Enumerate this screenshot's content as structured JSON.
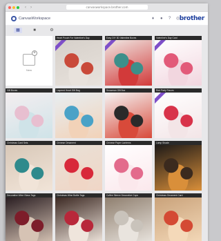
{
  "browser": {
    "url": "canvasworkspace.brother.com"
  },
  "header": {
    "app_title": "CanvasWorkspace",
    "brand": "brother",
    "icons": [
      "lightbulb-icon",
      "user-icon",
      "help-icon",
      "globe-icon"
    ]
  },
  "toolbar": {
    "icons": [
      "grid-view-icon",
      "category-icon",
      "settings-icon"
    ]
  },
  "upload": {
    "label": "New"
  },
  "projects": [
    {
      "caption": "Heart Pouch For Valentine's Day",
      "ribbon": true,
      "palette": [
        "#c94a3a",
        "#e8e2dc",
        "#d6d0ca"
      ]
    },
    {
      "caption": "Easy DIY 3D Valentine Boxes",
      "ribbon": true,
      "palette": [
        "#3d8f8a",
        "#d23a3a",
        "#efe7e3"
      ]
    },
    {
      "caption": "Valentine's Day Card",
      "ribbon": true,
      "palette": [
        "#e25a79",
        "#f2d6df",
        "#ffffff"
      ]
    },
    {
      "caption": "Gift Boxes",
      "ribbon": false,
      "palette": [
        "#e8bfd0",
        "#cfe3e8",
        "#f4eef0"
      ]
    },
    {
      "caption": "Layered Heart Gift Bag",
      "ribbon": false,
      "palette": [
        "#4aa2c7",
        "#f2d2b8",
        "#e7eef2"
      ]
    },
    {
      "caption": "Snowman Gift Box",
      "ribbon": false,
      "palette": [
        "#2a2a2a",
        "#d84a3a",
        "#f5f5f5"
      ]
    },
    {
      "caption": "Red Party Favors",
      "ribbon": true,
      "palette": [
        "#d8334a",
        "#f3e5e7",
        "#ffffff"
      ]
    },
    {
      "caption": "Christmas Card Sets",
      "ribbon": false,
      "palette": [
        "#2f8a8c",
        "#f1e4d8",
        "#d8c8b8"
      ]
    },
    {
      "caption": "Chinese Ornament",
      "ribbon": false,
      "palette": [
        "#d8293a",
        "#f0d6c6",
        "#e9e0d6"
      ]
    },
    {
      "caption": "Chinese Paper Lanterns",
      "ribbon": false,
      "palette": [
        "#e36b8c",
        "#fbe8ec",
        "#ffffff"
      ]
    },
    {
      "caption": "Lamp Shade",
      "ribbon": false,
      "palette": [
        "#3b2a1e",
        "#d98f3a",
        "#1e1a18"
      ]
    },
    {
      "caption": "Decorative Wine Glass Tags",
      "ribbon": false,
      "palette": [
        "#7d1d2a",
        "#d6c3b4",
        "#2a1e22"
      ]
    },
    {
      "caption": "Christmas Wine Bottle Tags",
      "ribbon": false,
      "palette": [
        "#b8283a",
        "#efe5dc",
        "#3d2a24"
      ]
    },
    {
      "caption": "Coffee Sleeve Decorative Cups",
      "ribbon": false,
      "palette": [
        "#c9c3bb",
        "#e9e4de",
        "#8f7f6f"
      ]
    },
    {
      "caption": "Christmas Ornament Card",
      "ribbon": false,
      "palette": [
        "#d44a34",
        "#f4d9b9",
        "#c9a27a"
      ]
    }
  ]
}
